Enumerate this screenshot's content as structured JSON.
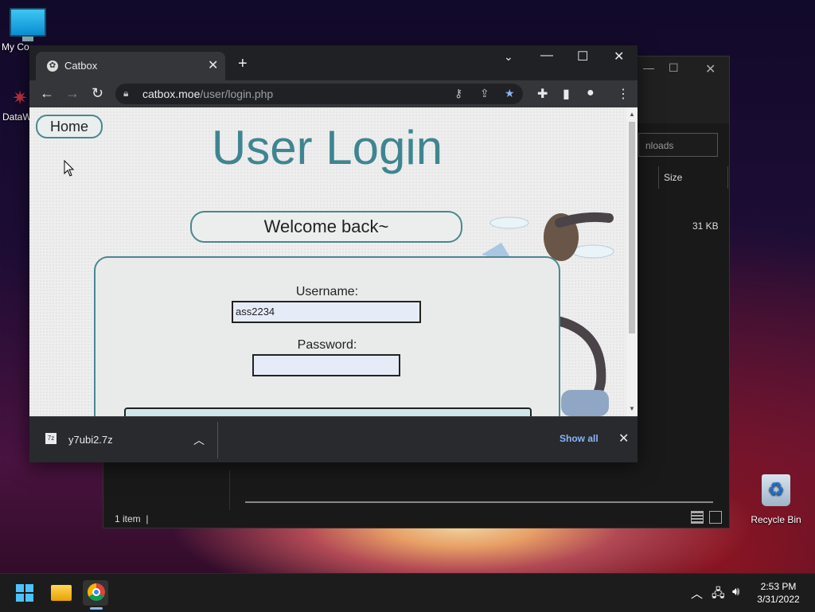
{
  "desktop": {
    "icons": [
      {
        "label": "My Co"
      },
      {
        "label": "DataW"
      },
      {
        "label": "Recycle Bin"
      }
    ]
  },
  "explorer": {
    "search_placeholder": "nloads",
    "column_size": "Size",
    "file_size": "31 KB",
    "status": "1 item"
  },
  "browser": {
    "tab_title": "Catbox",
    "url_host": "catbox.moe",
    "url_path": "/user/login.php",
    "page": {
      "home_label": "Home",
      "heading": "User Login",
      "welcome": "Welcome back~",
      "username_label": "Username:",
      "username_value": "ass2234",
      "password_label": "Password:",
      "password_value": ""
    },
    "download": {
      "filename": "y7ubi2.7z",
      "show_all": "Show all"
    }
  },
  "taskbar": {
    "time": "2:53 PM",
    "date": "3/31/2022"
  },
  "colors": {
    "accent": "#3f8591",
    "link": "#8ab4f8",
    "chrome_bg": "#202124"
  }
}
